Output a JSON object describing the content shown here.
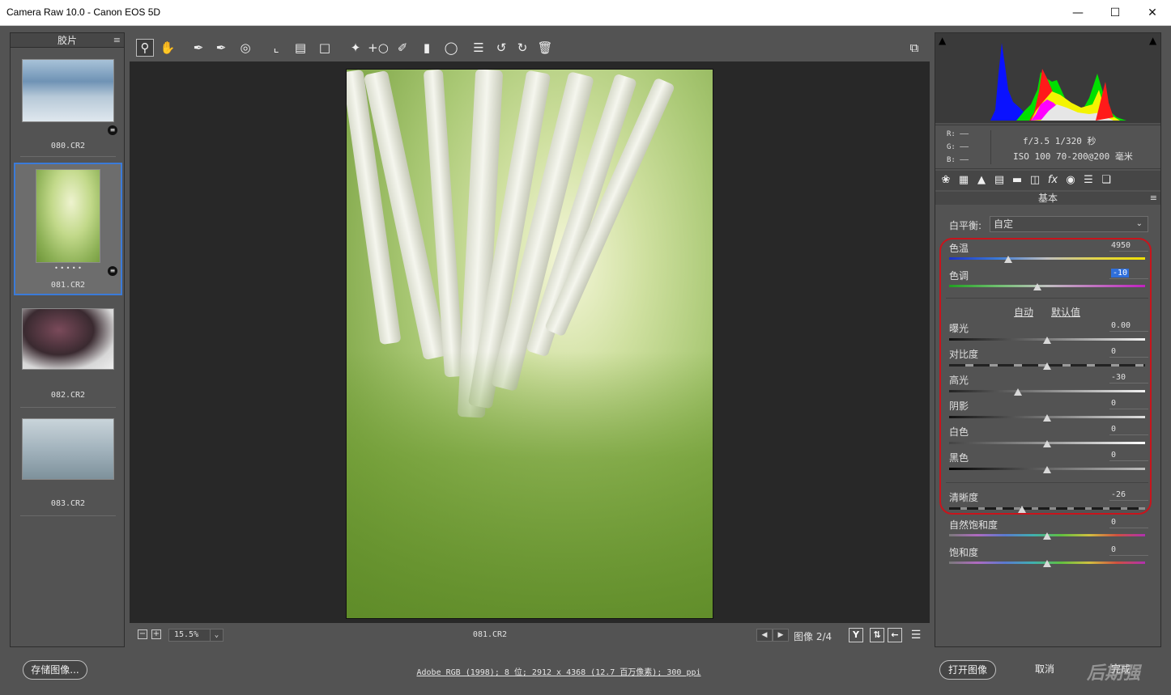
{
  "window": {
    "title": "Camera Raw 10.0 -  Canon EOS 5D",
    "minimize": "—",
    "maximize": "☐",
    "close": "✕"
  },
  "filmstrip": {
    "header": "胶片",
    "menu_icon": "≡",
    "items": [
      {
        "name": "080.CR2",
        "selected": false
      },
      {
        "name": "081.CR2",
        "selected": true,
        "dots": "• • • • •"
      },
      {
        "name": "082.CR2",
        "selected": false
      },
      {
        "name": "083.CR2",
        "selected": false
      }
    ]
  },
  "toolbar": {
    "tools": [
      "zoom-icon",
      "hand-icon",
      "white-balance-icon",
      "color-sampler-icon",
      "targeted-adjust-icon",
      "crop-icon",
      "straighten-icon",
      "transform-icon",
      "spot-removal-icon",
      "red-eye-icon",
      "adjustment-brush-icon",
      "graduated-filter-icon",
      "radial-filter-icon",
      "preferences-icon",
      "rotate-left-icon",
      "rotate-right-icon",
      "trash-icon"
    ],
    "fullscreen_icon": "fullscreen-icon"
  },
  "canvas_bottom": {
    "zoom_minus": "−",
    "zoom_plus": "+",
    "zoom_value": "15.5%",
    "filename": "081.CR2",
    "prev": "◀",
    "next": "▶",
    "image_count": "图像 2/4",
    "compare_label": "Y"
  },
  "readout": {
    "r": "R:  ——",
    "g": "G:  ——",
    "b": "B:  ——",
    "line1": "f/3.5  1/320 秒",
    "line2": "ISO 100  70-200@200 毫米"
  },
  "panel": {
    "title": "基本",
    "menu_icon": "≡",
    "white_balance_label": "白平衡:",
    "white_balance_value": "自定",
    "auto_label": "自动",
    "default_label": "默认值",
    "sliders": [
      {
        "key": "temp",
        "label": "色温",
        "value": "4950",
        "pos": 0.3
      },
      {
        "key": "tint",
        "label": "色调",
        "value": "-10",
        "pos": 0.45,
        "selected": true
      },
      {
        "key": "exposure",
        "label": "曝光",
        "value": "0.00",
        "pos": 0.5
      },
      {
        "key": "contrast",
        "label": "对比度",
        "value": "0",
        "pos": 0.5
      },
      {
        "key": "highlights",
        "label": "高光",
        "value": "-30",
        "pos": 0.35
      },
      {
        "key": "shadows",
        "label": "阴影",
        "value": "0",
        "pos": 0.5
      },
      {
        "key": "whites",
        "label": "白色",
        "value": "0",
        "pos": 0.5
      },
      {
        "key": "blacks",
        "label": "黑色",
        "value": "0",
        "pos": 0.5
      },
      {
        "key": "clarity",
        "label": "清晰度",
        "value": "-26",
        "pos": 0.37
      },
      {
        "key": "vibrance",
        "label": "自然饱和度",
        "value": "0",
        "pos": 0.5
      },
      {
        "key": "saturation",
        "label": "饱和度",
        "value": "0",
        "pos": 0.5
      }
    ]
  },
  "bottombar": {
    "save_label": "存储图像...",
    "info": "Adobe RGB (1998); 8 位; 2912 x 4368 (12.7 百万像素); 300 ppi",
    "open_label": "打开图像",
    "cancel_label": "取消",
    "done_label": "完成",
    "watermark": "后期强"
  },
  "colors": {
    "accent": "#3b7bd9",
    "highlight_ring": "#c8141c",
    "panel_bg": "#535353"
  }
}
